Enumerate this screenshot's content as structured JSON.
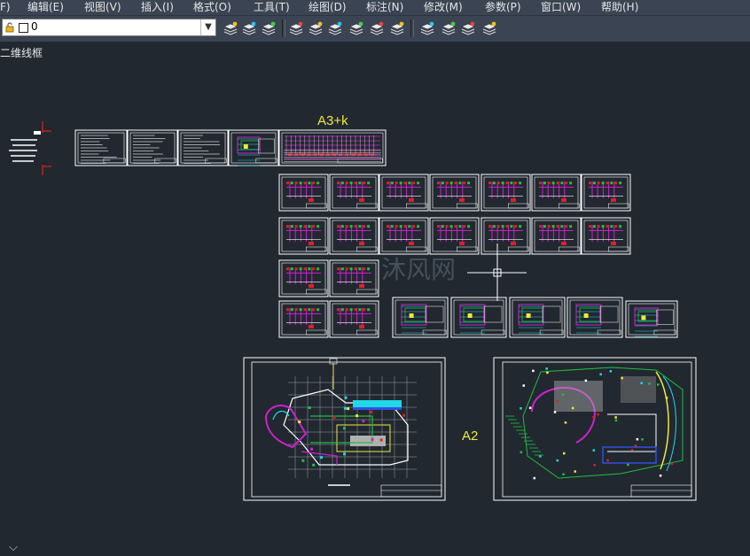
{
  "menubar": {
    "items": [
      {
        "label": "F)"
      },
      {
        "label": "编辑(E)"
      },
      {
        "label": "视图(V)"
      },
      {
        "label": "插入(I)"
      },
      {
        "label": "格式(O)"
      },
      {
        "label": "工具(T)"
      },
      {
        "label": "绘图(D)"
      },
      {
        "label": "标注(N)"
      },
      {
        "label": "修改(M)"
      },
      {
        "label": "参数(P)"
      },
      {
        "label": "窗口(W)"
      },
      {
        "label": "帮助(H)"
      }
    ]
  },
  "toolbar": {
    "layer_value": "0",
    "icons": [
      "layer-manager-icon",
      "layer-state-icon",
      "layer-previous-icon",
      "layer-match-icon",
      "layer-isolate-icon",
      "layer-unisolate-icon",
      "layer-off-icon",
      "layer-freeze-icon",
      "layer-lock-icon",
      "layer-walk-icon",
      "layer-merge-icon",
      "layer-delete-icon",
      "layer-lock-fade-icon"
    ]
  },
  "viewport": {
    "label": "二维线框"
  },
  "drawing": {
    "label_a3": "A3+k",
    "label_a2": "A2",
    "watermark": "沐风网",
    "colors": {
      "background": "#212830",
      "sheet": "#ffffff",
      "magenta": "#d020d0",
      "cyan": "#20d8e8",
      "yellow": "#f2e83a",
      "red": "#e02020",
      "green": "#20c040",
      "blue": "#3050e0"
    }
  },
  "ucs": {
    "glyph": "⌵"
  }
}
